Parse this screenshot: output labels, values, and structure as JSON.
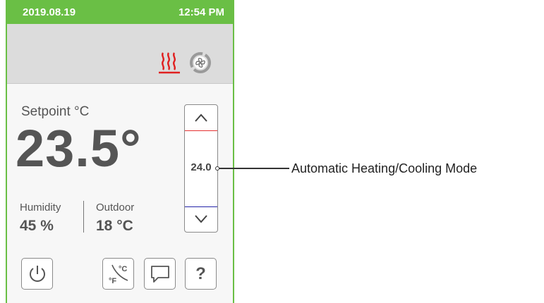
{
  "status_bar": {
    "date": "2019.08.19",
    "time": "12:54 PM"
  },
  "mode_bar": {
    "heating_icon": "heat-waves-icon",
    "fan_icon": "fan-icon",
    "heating_color": "#e02020"
  },
  "setpoint": {
    "label": "Setpoint °C",
    "value": "23.5°"
  },
  "humidity": {
    "label": "Humidity",
    "value": "45 %"
  },
  "outdoor": {
    "label": "Outdoor",
    "value": "18 °C"
  },
  "stepper": {
    "value": "24.0",
    "up_icon": "chevron-up-icon",
    "down_icon": "chevron-down-icon"
  },
  "buttons": {
    "power_icon": "power-icon",
    "units_icon": "fahrenheit-celsius-icon",
    "message_icon": "message-icon",
    "help_label": "?"
  },
  "annotation": {
    "text": "Automatic Heating/Cooling Mode"
  },
  "colors": {
    "status_bar": "#6abf45",
    "mode_bar": "#dcdcdc",
    "setpoint_high_line": "#e53030",
    "setpoint_low_line": "#2323a8"
  }
}
